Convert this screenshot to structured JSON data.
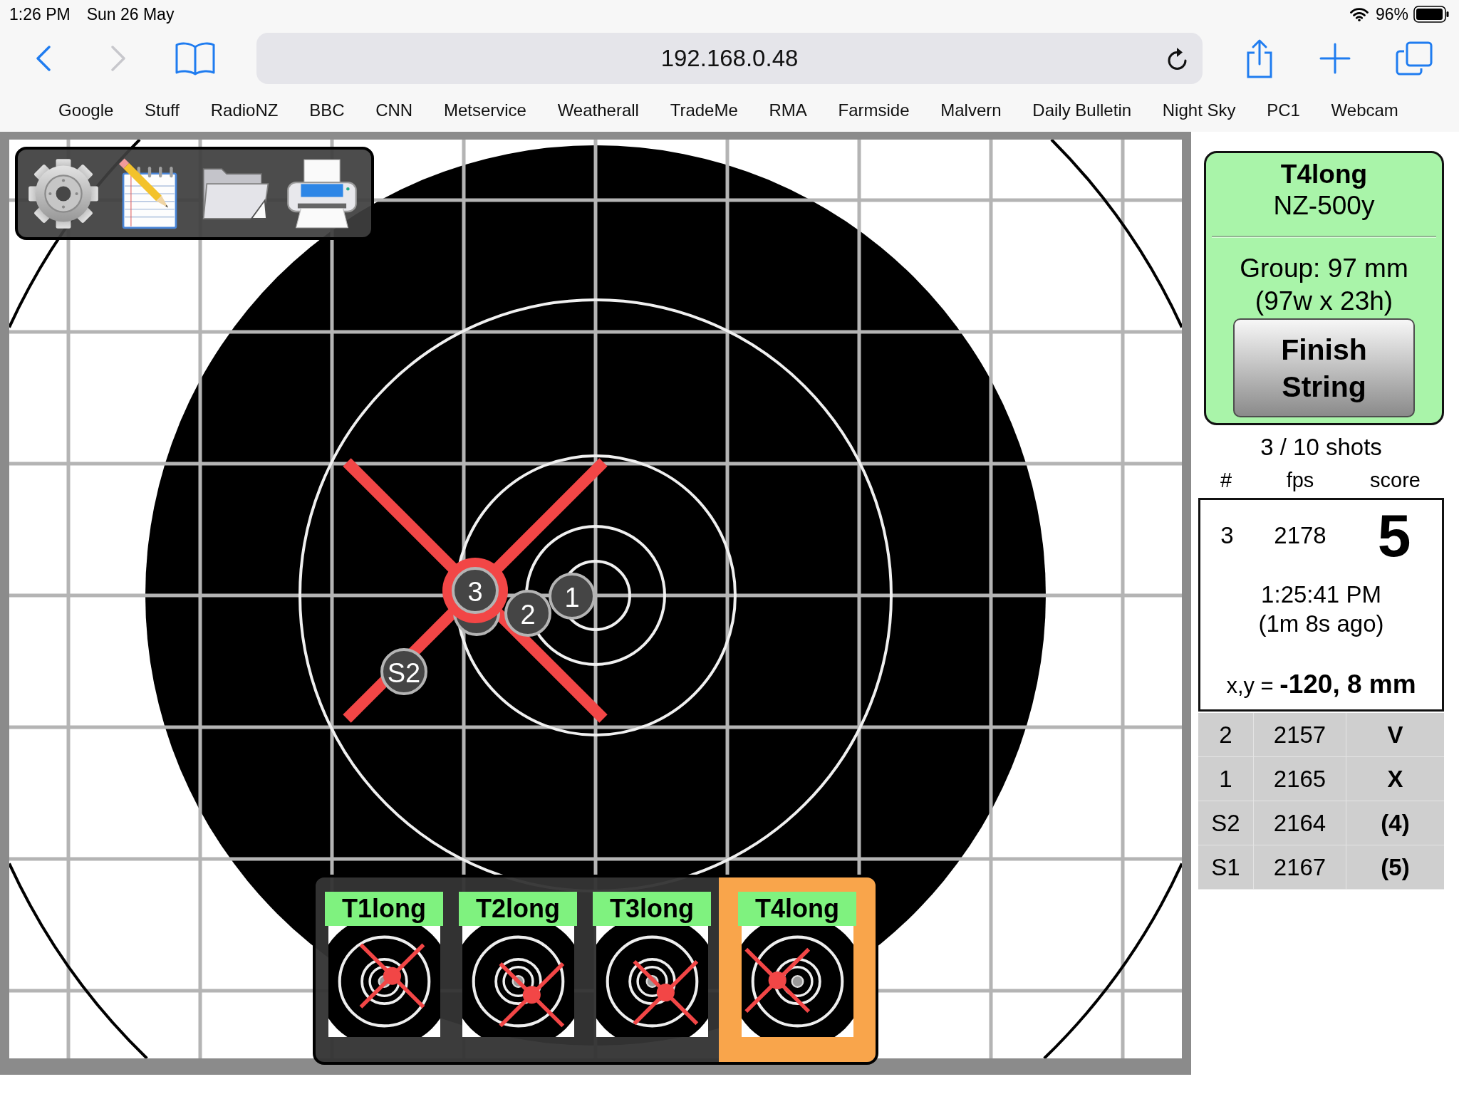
{
  "status_bar": {
    "time": "1:26 PM",
    "date": "Sun 26 May",
    "battery": "96%"
  },
  "browser": {
    "url": "192.168.0.48",
    "bookmarks": [
      "Google",
      "Stuff",
      "RadioNZ",
      "BBC",
      "CNN",
      "Metservice",
      "Weatherall",
      "TradeMe",
      "RMA",
      "Farmside",
      "Malvern",
      "Daily Bulletin",
      "Night Sky",
      "PC1",
      "Webcam"
    ]
  },
  "target": {
    "shots": [
      {
        "label": "S2",
        "kind": "shot"
      },
      {
        "kind": "covered"
      },
      {
        "label": "1",
        "kind": "shot"
      },
      {
        "label": "2",
        "kind": "shot"
      },
      {
        "label": "3",
        "kind": "latest"
      }
    ]
  },
  "target_tabs": [
    {
      "label": "T1long",
      "selected": false
    },
    {
      "label": "T2long",
      "selected": false
    },
    {
      "label": "T3long",
      "selected": false
    },
    {
      "label": "T4long",
      "selected": true
    }
  ],
  "summary": {
    "title": "T4long",
    "subtitle": "NZ-500y",
    "group": "Group: 97 mm",
    "group_size": "(97w x 23h)",
    "button": "Finish String"
  },
  "shots_panel": {
    "count": "3 / 10 shots",
    "columns": [
      "#",
      "fps",
      "score"
    ],
    "latest": {
      "number": "3",
      "fps": "2178",
      "score": "5",
      "time": "1:25:41 PM",
      "ago": "(1m 8s ago)",
      "position": "x,y = **-120, 8 mm**"
    },
    "rows": [
      {
        "number": "2",
        "fps": "2157",
        "score": "V"
      },
      {
        "number": "1",
        "fps": "2165",
        "score": "X"
      },
      {
        "number": "S2",
        "fps": "2164",
        "score": "(4)"
      },
      {
        "number": "S1",
        "fps": "2167",
        "score": "(5)"
      }
    ]
  }
}
